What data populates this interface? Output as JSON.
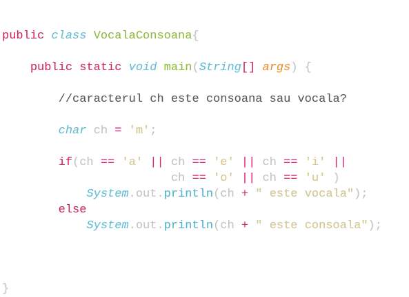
{
  "editor": {
    "lines": [
      [
        {
          "t": "public",
          "c": "kw"
        },
        {
          "t": " ",
          "c": "plain"
        },
        {
          "t": "class",
          "c": "typ"
        },
        {
          "t": " ",
          "c": "plain"
        },
        {
          "t": "VocalaConsoana",
          "c": "cls"
        },
        {
          "t": "{",
          "c": "plain"
        }
      ],
      [],
      [
        {
          "t": "    ",
          "c": "plain"
        },
        {
          "t": "public",
          "c": "kw"
        },
        {
          "t": " ",
          "c": "plain"
        },
        {
          "t": "static",
          "c": "kw"
        },
        {
          "t": " ",
          "c": "plain"
        },
        {
          "t": "void",
          "c": "typ"
        },
        {
          "t": " ",
          "c": "plain"
        },
        {
          "t": "main",
          "c": "cls"
        },
        {
          "t": "(",
          "c": "plain"
        },
        {
          "t": "String",
          "c": "typ"
        },
        {
          "t": "[]",
          "c": "kw"
        },
        {
          "t": " ",
          "c": "plain"
        },
        {
          "t": "args",
          "c": "param"
        },
        {
          "t": ") {",
          "c": "plain"
        }
      ],
      [],
      [
        {
          "t": "        ",
          "c": "plain"
        },
        {
          "t": "//caracterul ch este consoana sau vocala?",
          "c": "cmt"
        }
      ],
      [],
      [
        {
          "t": "        ",
          "c": "plain"
        },
        {
          "t": "char",
          "c": "typ"
        },
        {
          "t": " ch ",
          "c": "plain"
        },
        {
          "t": "=",
          "c": "op"
        },
        {
          "t": " ",
          "c": "plain"
        },
        {
          "t": "'m'",
          "c": "str"
        },
        {
          "t": ";",
          "c": "plain"
        }
      ],
      [],
      [
        {
          "t": "        ",
          "c": "plain"
        },
        {
          "t": "if",
          "c": "kw"
        },
        {
          "t": "(ch ",
          "c": "plain"
        },
        {
          "t": "==",
          "c": "op"
        },
        {
          "t": " ",
          "c": "plain"
        },
        {
          "t": "'a'",
          "c": "str"
        },
        {
          "t": " ",
          "c": "plain"
        },
        {
          "t": "||",
          "c": "op"
        },
        {
          "t": " ch ",
          "c": "plain"
        },
        {
          "t": "==",
          "c": "op"
        },
        {
          "t": " ",
          "c": "plain"
        },
        {
          "t": "'e'",
          "c": "str"
        },
        {
          "t": " ",
          "c": "plain"
        },
        {
          "t": "||",
          "c": "op"
        },
        {
          "t": " ch ",
          "c": "plain"
        },
        {
          "t": "==",
          "c": "op"
        },
        {
          "t": " ",
          "c": "plain"
        },
        {
          "t": "'i'",
          "c": "str"
        },
        {
          "t": " ",
          "c": "plain"
        },
        {
          "t": "||",
          "c": "op"
        }
      ],
      [
        {
          "t": "                        ch ",
          "c": "plain"
        },
        {
          "t": "==",
          "c": "op"
        },
        {
          "t": " ",
          "c": "plain"
        },
        {
          "t": "'o'",
          "c": "str"
        },
        {
          "t": " ",
          "c": "plain"
        },
        {
          "t": "||",
          "c": "op"
        },
        {
          "t": " ch ",
          "c": "plain"
        },
        {
          "t": "==",
          "c": "op"
        },
        {
          "t": " ",
          "c": "plain"
        },
        {
          "t": "'u'",
          "c": "str"
        },
        {
          "t": " )",
          "c": "plain"
        }
      ],
      [
        {
          "t": "            ",
          "c": "plain"
        },
        {
          "t": "System",
          "c": "typ"
        },
        {
          "t": ".out.",
          "c": "plain"
        },
        {
          "t": "println",
          "c": "fn"
        },
        {
          "t": "(ch ",
          "c": "plain"
        },
        {
          "t": "+",
          "c": "op"
        },
        {
          "t": " ",
          "c": "plain"
        },
        {
          "t": "\" este vocala\"",
          "c": "str"
        },
        {
          "t": ");",
          "c": "plain"
        }
      ],
      [
        {
          "t": "        ",
          "c": "plain"
        },
        {
          "t": "else",
          "c": "kw"
        }
      ],
      [
        {
          "t": "            ",
          "c": "plain"
        },
        {
          "t": "System",
          "c": "typ"
        },
        {
          "t": ".out.",
          "c": "plain"
        },
        {
          "t": "println",
          "c": "fn"
        },
        {
          "t": "(ch ",
          "c": "plain"
        },
        {
          "t": "+",
          "c": "op"
        },
        {
          "t": " ",
          "c": "plain"
        },
        {
          "t": "\" este consoala\"",
          "c": "str"
        },
        {
          "t": ");",
          "c": "plain"
        }
      ],
      [],
      [],
      [],
      [
        {
          "t": "}",
          "c": "plain"
        }
      ]
    ]
  }
}
